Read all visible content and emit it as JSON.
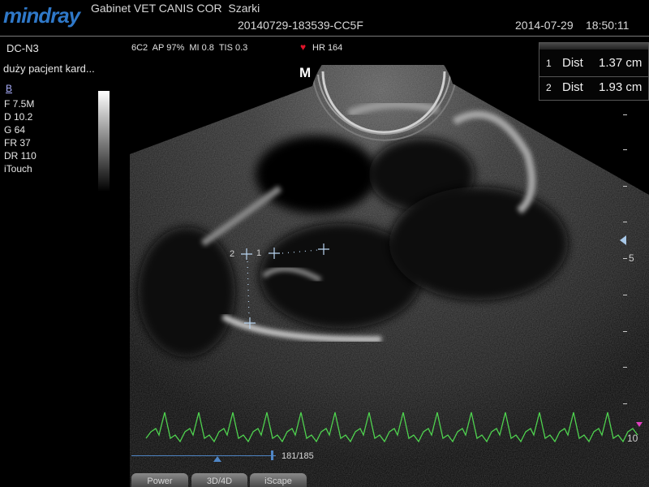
{
  "header": {
    "brand": "mindray",
    "clinic": "Gabinet VET CANIS COR  Szarki",
    "study_id": "20140729-183539-CC5F",
    "date": "2014-07-29",
    "time": "18:50:11"
  },
  "probe": "DC-N3",
  "exam_preset": "duży pacjent kard...",
  "imaging_params": "6C2  AP 97%  MI 0.8  TIS 0.3",
  "heart_rate": "HR 164",
  "mode": "B",
  "params": [
    {
      "label": "F 7.5M"
    },
    {
      "label": "D 10.2"
    },
    {
      "label": "G 64"
    },
    {
      "label": "FR 37"
    },
    {
      "label": "DR 110"
    },
    {
      "label": "iTouch"
    }
  ],
  "orientation_marker": "M",
  "measurements": [
    {
      "index": "1",
      "label": "Dist",
      "value": "1.37 cm"
    },
    {
      "index": "2",
      "label": "Dist",
      "value": "1.93 cm"
    }
  ],
  "caliper_labels": {
    "one": "1",
    "two": "2"
  },
  "depth_scale": {
    "mid": "5",
    "max": "10"
  },
  "cine": {
    "counter": "181/185",
    "frame": 181,
    "total": 185
  },
  "softkeys": [
    {
      "label": "Power"
    },
    {
      "label": "3D/4D"
    },
    {
      "label": "iScape"
    }
  ],
  "colors": {
    "brand": "#2f78c8",
    "ecg_trace": "#4fd24f",
    "heart_icon": "#e0142a",
    "caliper": "#b8d4f0",
    "cine_bar": "#4f86c6"
  },
  "icons": [
    "heart-icon",
    "focus-marker-icon",
    "cine-thumb-icon"
  ]
}
